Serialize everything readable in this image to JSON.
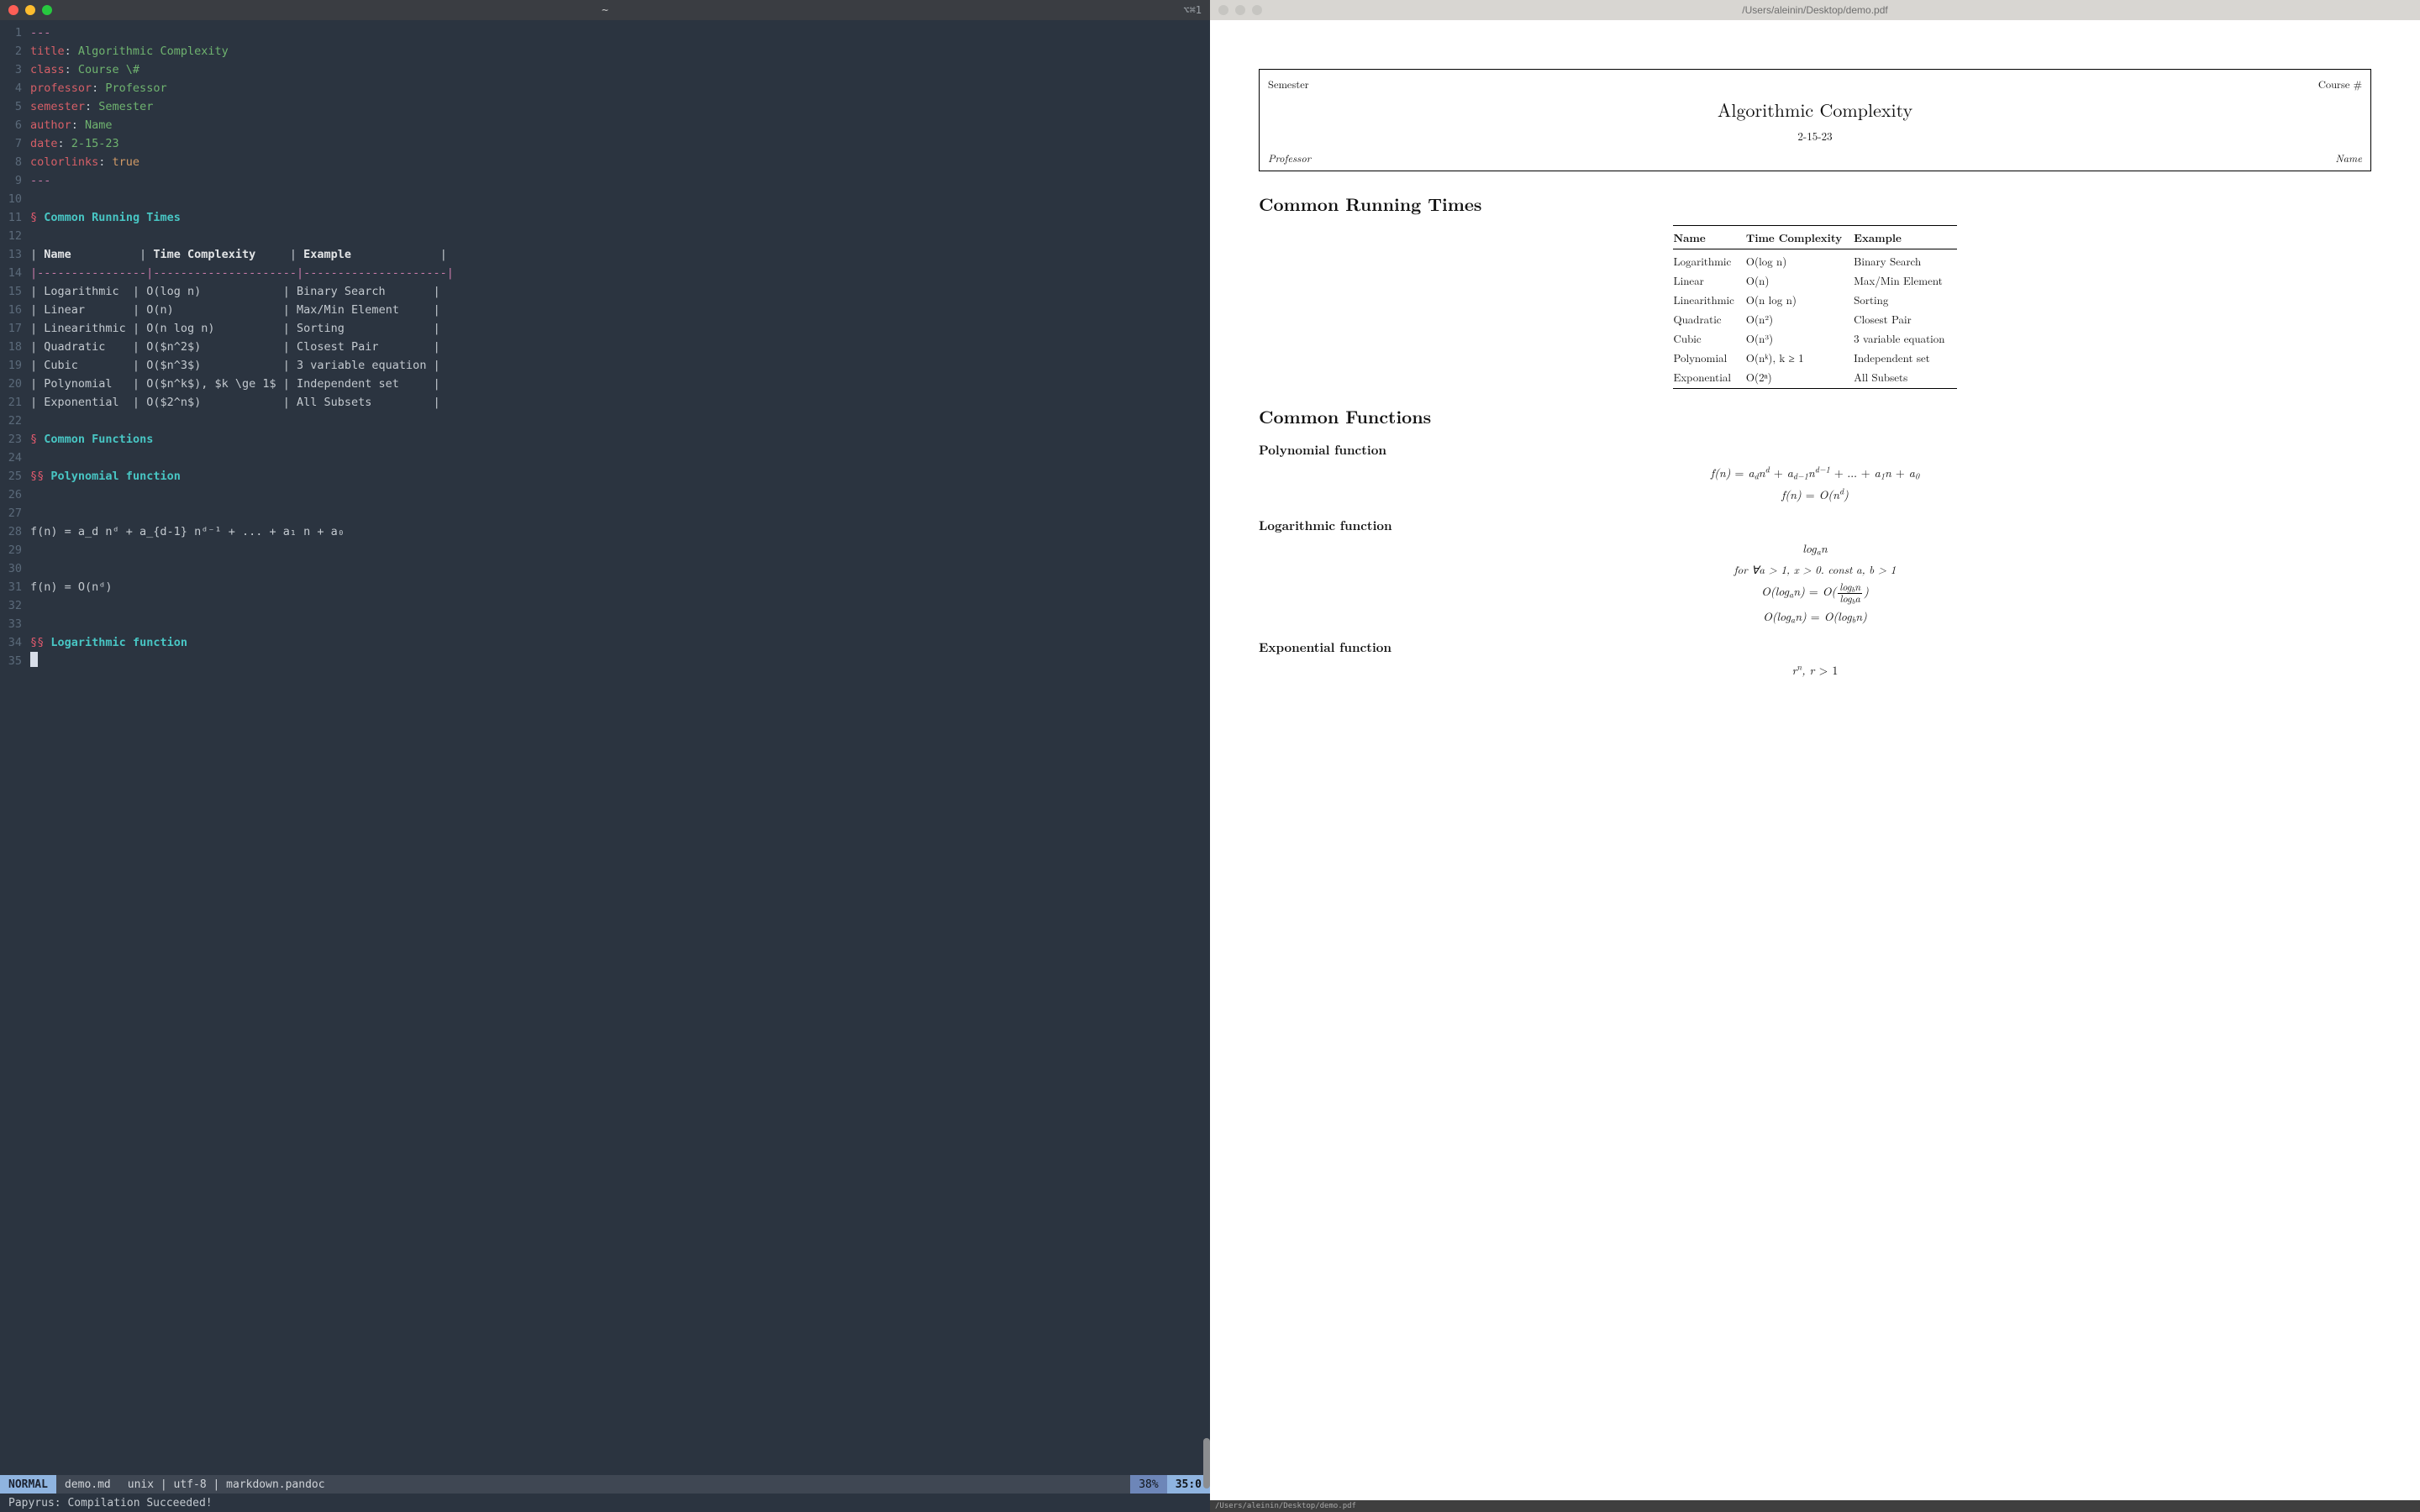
{
  "editor": {
    "window_title": "~",
    "window_hint": "⌥⌘1",
    "frontmatter": {
      "title_key": "title",
      "title_val": "Algorithmic Complexity",
      "class_key": "class",
      "class_val": "Course \\#",
      "prof_key": "professor",
      "prof_val": "Professor",
      "sem_key": "semester",
      "sem_val": "Semester",
      "auth_key": "author",
      "auth_val": "Name",
      "date_key": "date",
      "date_val": "2-15-23",
      "color_key": "colorlinks",
      "color_val": "true",
      "delim": "---"
    },
    "sec1_mark": "§",
    "sec1_name": "Common Running Times",
    "tbl_head": {
      "c1": "Name",
      "c2": "Time Complexity",
      "c3": "Example"
    },
    "tbl_rule": "|----------------|---------------------|---------------------|",
    "tbl_rows": [
      {
        "c1": "Logarithmic",
        "c2": "O(log n)",
        "c3": "Binary Search"
      },
      {
        "c1": "Linear",
        "c2": "O(n)",
        "c3": "Max/Min Element"
      },
      {
        "c1": "Linearithmic",
        "c2": "O(n log n)",
        "c3": "Sorting"
      },
      {
        "c1": "Quadratic",
        "c2": "O($n^2$)",
        "c3": "Closest Pair"
      },
      {
        "c1": "Cubic",
        "c2": "O($n^3$)",
        "c3": "3 variable equation"
      },
      {
        "c1": "Polynomial",
        "c2": "O($n^k$), $k \\ge 1$",
        "c3": "Independent set"
      },
      {
        "c1": "Exponential",
        "c2": "O($2^n$)",
        "c3": "All Subsets"
      }
    ],
    "sec2_mark": "§",
    "sec2_name": "Common Functions",
    "sub_poly_mark": "§§",
    "sub_poly_name": "Polynomial function",
    "eq_poly_1": "f(n) = a_d nᵈ + a_{d-1} nᵈ⁻¹ + ... + a₁ n + a₀",
    "eq_poly_2": "f(n) = O(nᵈ)",
    "sub_log_mark": "§§",
    "sub_log_name": "Logarithmic function",
    "line_numbers": [
      "1",
      "2",
      "3",
      "4",
      "5",
      "6",
      "7",
      "8",
      "9",
      "10",
      "11",
      "12",
      "13",
      "14",
      "15",
      "16",
      "17",
      "18",
      "19",
      "20",
      "21",
      "22",
      "23",
      "24",
      "25",
      "26",
      "27",
      "28",
      "29",
      "30",
      "31",
      "32",
      "33",
      "34",
      "35"
    ],
    "status": {
      "mode": "NORMAL",
      "file": "demo.md",
      "mid": "unix | utf-8 | markdown.pandoc",
      "pct": "38%",
      "pos": "35:0"
    },
    "message": "Papyrus: Compilation Succeeded!"
  },
  "pdf": {
    "window_title": "/Users/aleinin/Desktop/demo.pdf",
    "bottom_path": "/Users/aleinin/Desktop/demo.pdf",
    "header": {
      "top_left": "Semester",
      "top_right": "Course #",
      "title": "Algorithmic Complexity",
      "date": "2-15-23",
      "bot_left": "Professor",
      "bot_right": "Name"
    },
    "sec1": "Common Running Times",
    "table": {
      "head": {
        "c1": "Name",
        "c2": "Time Complexity",
        "c3": "Example"
      },
      "rows": [
        {
          "c1": "Logarithmic",
          "c2": "O(log n)",
          "c3": "Binary Search"
        },
        {
          "c1": "Linear",
          "c2": "O(n)",
          "c3": "Max/Min Element"
        },
        {
          "c1": "Linearithmic",
          "c2": "O(n log n)",
          "c3": "Sorting"
        },
        {
          "c1": "Quadratic",
          "c2": "O(n²)",
          "c3": "Closest Pair"
        },
        {
          "c1": "Cubic",
          "c2": "O(n³)",
          "c3": "3 variable equation"
        },
        {
          "c1": "Polynomial",
          "c2": "O(nᵏ), k ≥ 1",
          "c3": "Independent set"
        },
        {
          "c1": "Exponential",
          "c2": "O(2ⁿ)",
          "c3": "All Subsets"
        }
      ]
    },
    "sec2": "Common Functions",
    "sub_poly": "Polynomial function",
    "sub_log": "Logarithmic function",
    "sub_exp": "Exponential function",
    "eq_log_cond": "for ∀a > 1, x > 0. const a, b > 1"
  }
}
